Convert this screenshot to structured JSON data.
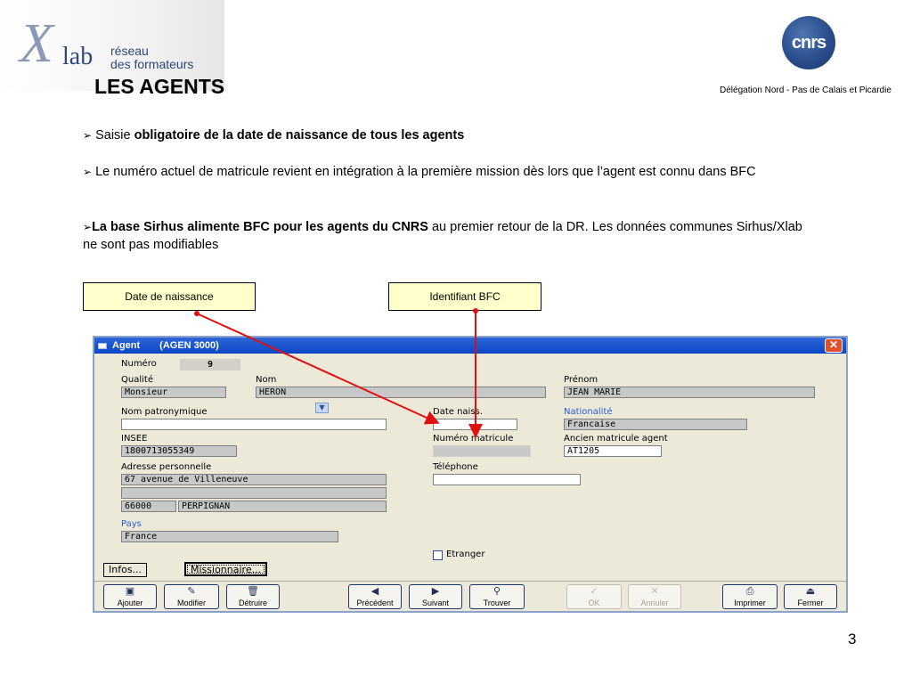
{
  "header": {
    "logo_x": "X",
    "logo_lab": "lab",
    "logo_reseau": "réseau",
    "logo_formateurs": "des formateurs",
    "title": "LES AGENTS",
    "cnrs_logo": "cnrs",
    "delegation": "Délégation Nord - Pas de Calais et Picardie"
  },
  "bullets": {
    "marker": "➢",
    "b1_plain": " Saisie ",
    "b1_bold": "obligatoire de la date de naissance de tous les agents",
    "b2": " Le numéro actuel de matricule revient en intégration à la première mission dès lors que l’agent est connu dans BFC",
    "b3_bold": "La base Sirhus alimente BFC pour  les agents du CNRS",
    "b3_plain": " au premier retour de la DR. Les données communes Sirhus/Xlab ne sont pas modifiables"
  },
  "callouts": {
    "date_naissance": "Date de naissance",
    "identifiant_bfc": "Identifiant BFC"
  },
  "window": {
    "title": "Agent",
    "subtitle": "(AGEN 3000)",
    "close_glyph": "✕"
  },
  "form": {
    "numero_label": "Numéro",
    "numero_value": "9",
    "qualite_label": "Qualité",
    "qualite_value": "Monsieur",
    "nom_label": "Nom",
    "nom_value": "HERON",
    "prenom_label": "Prénom",
    "prenom_value": "JEAN MARIE",
    "nom_patronymique_label": "Nom patronymique",
    "nom_patronymique_value": "",
    "date_naiss_label": "Date naiss.",
    "date_naiss_value": "",
    "nationalite_label": "Nationalité",
    "nationalite_value": "Francaise",
    "insee_label": "INSEE",
    "insee_value": "1800713055349",
    "numero_matricule_label": "Numéro matricule",
    "numero_matricule_value": "",
    "ancien_matricule_label": "Ancien matricule agent",
    "ancien_matricule_value": "AT1205",
    "adresse_label": "Adresse personnelle",
    "adresse_line1": "67 avenue de Villeneuve",
    "adresse_line2": "",
    "code_postal": "66000",
    "ville": "PERPIGNAN",
    "telephone_label": "Téléphone",
    "telephone_value": "",
    "pays_label": "Pays",
    "pays_value": "France",
    "etranger_label": "Etranger",
    "infos_button": "Infos...",
    "missionnaire_button": "Missionnaire..."
  },
  "toolbar": {
    "ajouter": "Ajouter",
    "modifier": "Modifier",
    "detruire": "Détruire",
    "precedent": "Précédent",
    "suivant": "Suivant",
    "trouver": "Trouver",
    "ok": "OK",
    "annuler": "Annuler",
    "imprimer": "Imprimer",
    "fermer": "Fermer"
  },
  "page_number": "3",
  "colors": {
    "callout_bg": "#ffffcc",
    "arrow": "#e01010",
    "titlebar": "#0b45c4"
  }
}
